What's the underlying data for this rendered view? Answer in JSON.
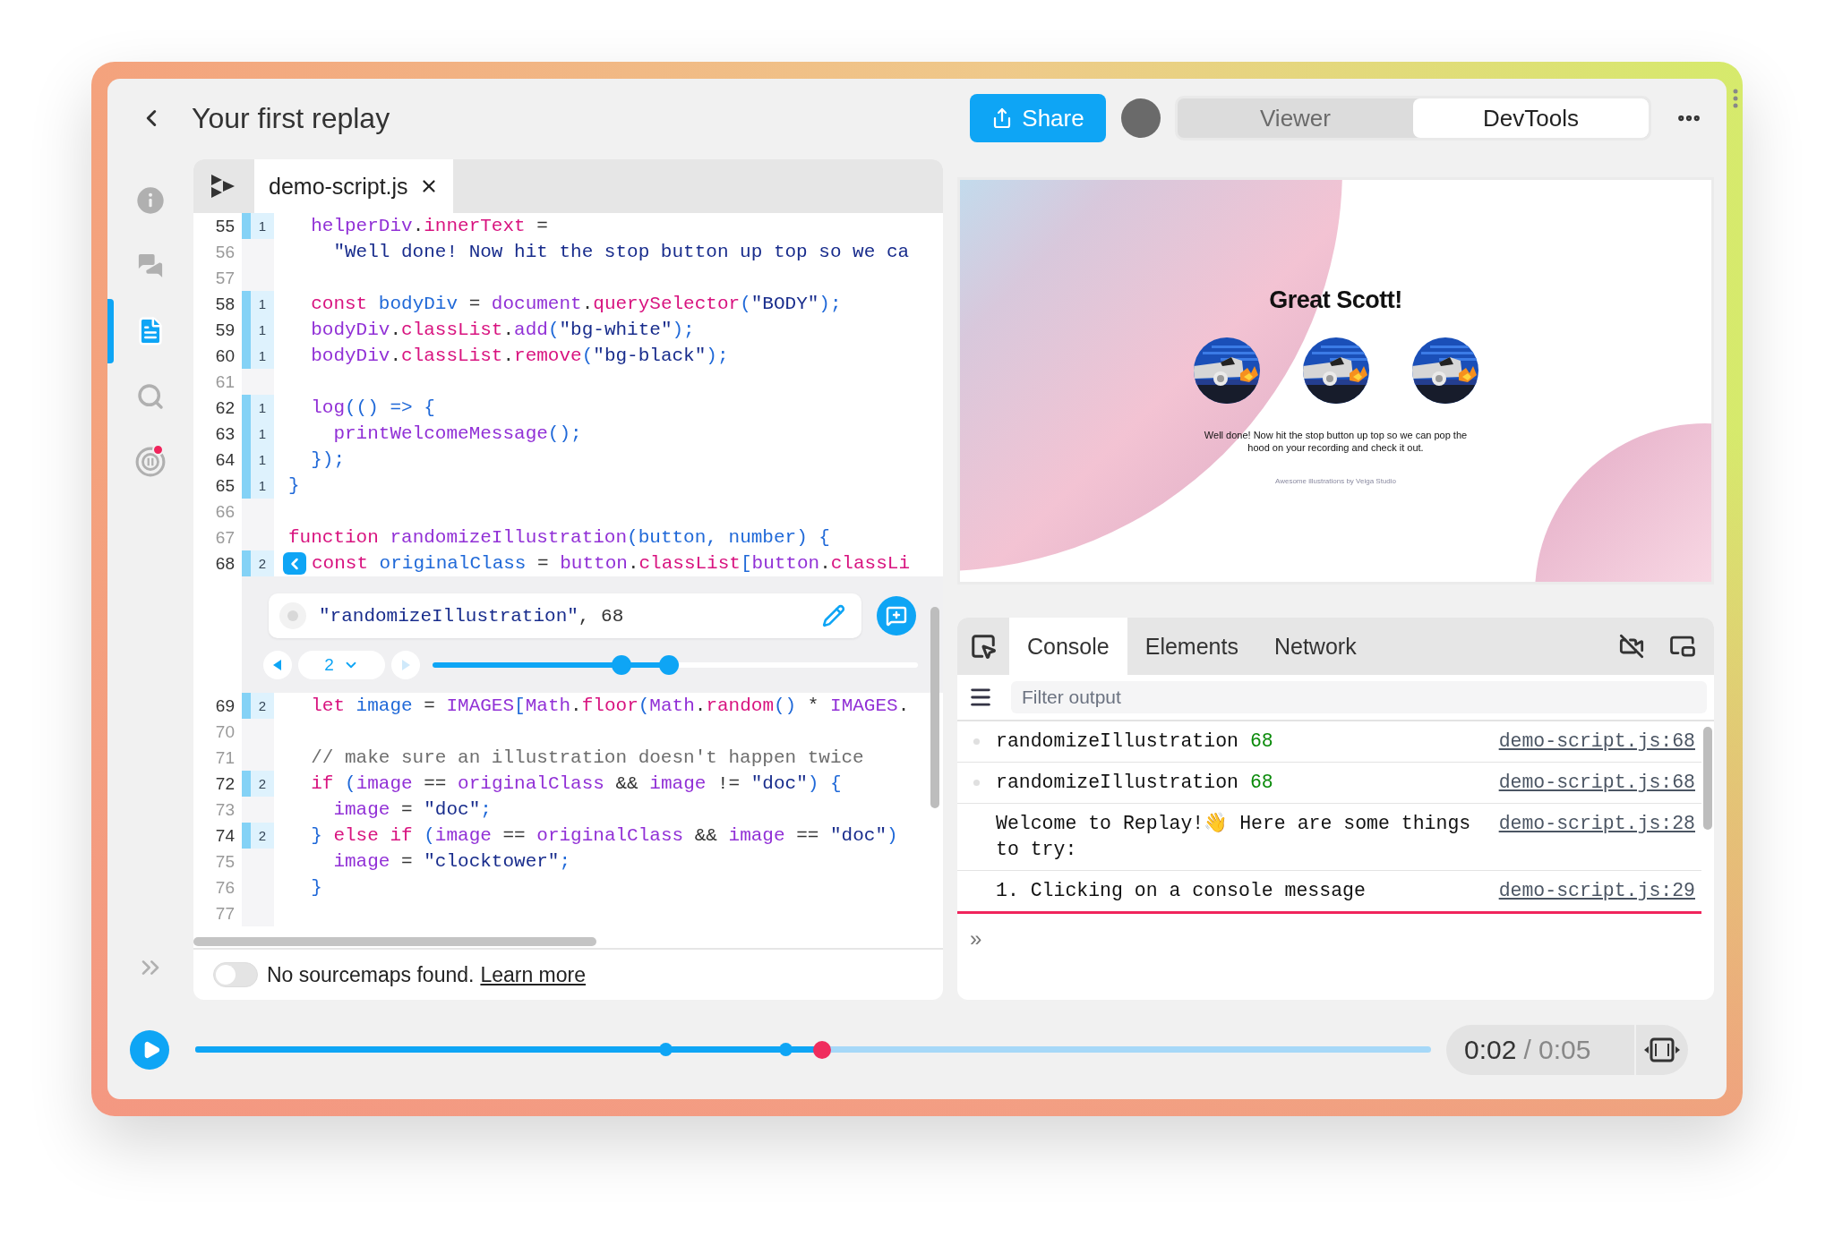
{
  "window": {
    "title": "Your first replay"
  },
  "header": {
    "share": "Share",
    "view_toggle": [
      {
        "label": "Viewer",
        "selected": false
      },
      {
        "label": "DevTools",
        "selected": true
      }
    ]
  },
  "sidebar": {
    "items": [
      {
        "selected": false,
        "badge": false
      },
      {
        "selected": false,
        "badge": false
      },
      {
        "selected": true,
        "badge": false
      },
      {
        "selected": false,
        "badge": false
      },
      {
        "selected": false,
        "badge": true
      }
    ]
  },
  "editor": {
    "tab": {
      "label": "demo-script.js"
    },
    "lines": [
      {
        "number": "55",
        "hits": "1",
        "current": false,
        "tokens": [
          {
            "kind": "var",
            "text": "  helperDiv"
          },
          {
            "kind": "plain",
            "text": "."
          },
          {
            "kind": "prop",
            "text": "innerText"
          },
          {
            "kind": "plain",
            "text": " ="
          }
        ]
      },
      {
        "number": "56",
        "current": false,
        "tokens": [
          {
            "kind": "str",
            "text": "    \"Well done! Now hit the stop button up top so we ca"
          }
        ]
      },
      {
        "number": "57",
        "current": false
      },
      {
        "number": "58",
        "hits": "1",
        "current": false,
        "tokens": [
          {
            "kind": "kw",
            "text": "  const"
          },
          {
            "kind": "def",
            "text": " bodyDiv"
          },
          {
            "kind": "plain",
            "text": " = "
          },
          {
            "kind": "var",
            "text": "document"
          },
          {
            "kind": "plain",
            "text": "."
          },
          {
            "kind": "prop",
            "text": "querySelector"
          },
          {
            "kind": "punct",
            "text": "("
          },
          {
            "kind": "str",
            "text": "\"BODY\""
          },
          {
            "kind": "punct",
            "text": ");"
          }
        ]
      },
      {
        "number": "59",
        "hits": "1",
        "current": false,
        "tokens": [
          {
            "kind": "var",
            "text": "  bodyDiv"
          },
          {
            "kind": "plain",
            "text": "."
          },
          {
            "kind": "prop",
            "text": "classList"
          },
          {
            "kind": "plain",
            "text": "."
          },
          {
            "kind": "var",
            "text": "add"
          },
          {
            "kind": "punct",
            "text": "("
          },
          {
            "kind": "str",
            "text": "\"bg-white\""
          },
          {
            "kind": "punct",
            "text": ");"
          }
        ]
      },
      {
        "number": "60",
        "hits": "1",
        "current": false,
        "tokens": [
          {
            "kind": "var",
            "text": "  bodyDiv"
          },
          {
            "kind": "plain",
            "text": "."
          },
          {
            "kind": "prop",
            "text": "classList"
          },
          {
            "kind": "plain",
            "text": "."
          },
          {
            "kind": "prop",
            "text": "remove"
          },
          {
            "kind": "punct",
            "text": "("
          },
          {
            "kind": "str",
            "text": "\"bg-black\""
          },
          {
            "kind": "punct",
            "text": ");"
          }
        ]
      },
      {
        "number": "61",
        "current": false
      },
      {
        "number": "62",
        "hits": "1",
        "current": false,
        "tokens": [
          {
            "kind": "var",
            "text": "  log"
          },
          {
            "kind": "punct",
            "text": "(() => {"
          }
        ]
      },
      {
        "number": "63",
        "hits": "1",
        "current": false,
        "tokens": [
          {
            "kind": "var",
            "text": "    printWelcomeMessage"
          },
          {
            "kind": "punct",
            "text": "();"
          }
        ]
      },
      {
        "number": "64",
        "hits": "1",
        "current": false,
        "tokens": [
          {
            "kind": "punct",
            "text": "  });"
          }
        ]
      },
      {
        "number": "65",
        "hits": "1",
        "current": false,
        "tokens": [
          {
            "kind": "punct",
            "text": "}"
          }
        ]
      },
      {
        "number": "66",
        "current": false
      },
      {
        "number": "67",
        "current": false,
        "tokens": [
          {
            "kind": "kw",
            "text": "function"
          },
          {
            "kind": "var",
            "text": " randomizeIllustration"
          },
          {
            "kind": "punct",
            "text": "("
          },
          {
            "kind": "def",
            "text": "button"
          },
          {
            "kind": "punct",
            "text": ", "
          },
          {
            "kind": "def",
            "text": "number"
          },
          {
            "kind": "punct",
            "text": ") {"
          }
        ]
      },
      {
        "number": "68",
        "hits": "2",
        "current": true,
        "tokens": [
          {
            "kind": "kw",
            "text": "const"
          },
          {
            "kind": "def",
            "text": " originalClass"
          },
          {
            "kind": "plain",
            "text": " = "
          },
          {
            "kind": "var",
            "text": "button"
          },
          {
            "kind": "plain",
            "text": "."
          },
          {
            "kind": "prop",
            "text": "classList"
          },
          {
            "kind": "punct",
            "text": "["
          },
          {
            "kind": "var",
            "text": "button"
          },
          {
            "kind": "plain",
            "text": "."
          },
          {
            "kind": "prop",
            "text": "classLi"
          }
        ],
        "logpoint": {
          "tokens": [
            {
              "kind": "str",
              "text": "\"randomizeIllustration\""
            },
            {
              "kind": "plain",
              "text": ", 68"
            }
          ],
          "hit": "2",
          "prev_enabled": true,
          "next_enabled": false,
          "level": 0.487,
          "markers": [
            {
              "level": 0.389
            }
          ]
        }
      },
      {
        "number": "69",
        "hits": "2",
        "current": false,
        "tokens": [
          {
            "kind": "kw",
            "text": "  let"
          },
          {
            "kind": "def",
            "text": " image"
          },
          {
            "kind": "plain",
            "text": " = "
          },
          {
            "kind": "var",
            "text": "IMAGES"
          },
          {
            "kind": "punct",
            "text": "["
          },
          {
            "kind": "var",
            "text": "Math"
          },
          {
            "kind": "plain",
            "text": "."
          },
          {
            "kind": "prop",
            "text": "floor"
          },
          {
            "kind": "punct",
            "text": "("
          },
          {
            "kind": "var",
            "text": "Math"
          },
          {
            "kind": "plain",
            "text": "."
          },
          {
            "kind": "prop",
            "text": "random"
          },
          {
            "kind": "punct",
            "text": "()"
          },
          {
            "kind": "plain",
            "text": " * "
          },
          {
            "kind": "var",
            "text": "IMAGES"
          },
          {
            "kind": "plain",
            "text": "."
          }
        ]
      },
      {
        "number": "70",
        "current": false
      },
      {
        "number": "71",
        "current": false,
        "tokens": [
          {
            "kind": "comment",
            "text": "  // make sure an illustration doesn't happen twice"
          }
        ]
      },
      {
        "number": "72",
        "hits": "2",
        "current": false,
        "tokens": [
          {
            "kind": "kw",
            "text": "  if"
          },
          {
            "kind": "punct",
            "text": " ("
          },
          {
            "kind": "var",
            "text": "image"
          },
          {
            "kind": "plain",
            "text": " == "
          },
          {
            "kind": "var",
            "text": "originalClass"
          },
          {
            "kind": "plain",
            "text": " && "
          },
          {
            "kind": "var",
            "text": "image"
          },
          {
            "kind": "plain",
            "text": " != "
          },
          {
            "kind": "str",
            "text": "\"doc\""
          },
          {
            "kind": "punct",
            "text": ") {"
          }
        ]
      },
      {
        "number": "73",
        "current": false,
        "tokens": [
          {
            "kind": "var",
            "text": "    image"
          },
          {
            "kind": "plain",
            "text": " = "
          },
          {
            "kind": "str",
            "text": "\"doc\""
          },
          {
            "kind": "punct",
            "text": ";"
          }
        ]
      },
      {
        "number": "74",
        "hits": "2",
        "current": false,
        "tokens": [
          {
            "kind": "punct",
            "text": "  }"
          },
          {
            "kind": "kw",
            "text": " else if"
          },
          {
            "kind": "punct",
            "text": " ("
          },
          {
            "kind": "var",
            "text": "image"
          },
          {
            "kind": "plain",
            "text": " == "
          },
          {
            "kind": "var",
            "text": "originalClass"
          },
          {
            "kind": "plain",
            "text": " && "
          },
          {
            "kind": "var",
            "text": "image"
          },
          {
            "kind": "plain",
            "text": " == "
          },
          {
            "kind": "str",
            "text": "\"doc\""
          },
          {
            "kind": "punct",
            "text": ")"
          }
        ]
      },
      {
        "number": "75",
        "current": false,
        "tokens": [
          {
            "kind": "var",
            "text": "    image"
          },
          {
            "kind": "plain",
            "text": " = "
          },
          {
            "kind": "str",
            "text": "\"clocktower\""
          },
          {
            "kind": "punct",
            "text": ";"
          }
        ]
      },
      {
        "number": "76",
        "current": false,
        "tokens": [
          {
            "kind": "punct",
            "text": "  }"
          }
        ]
      },
      {
        "number": "77",
        "current": false
      }
    ],
    "footer": {
      "toggle_on": false,
      "message": "No sourcemaps found.",
      "link": "Learn more"
    }
  },
  "preview": {
    "heading": "Great Scott!",
    "message": "Well done! Now hit the stop button up top so we can pop the hood on your recording and check it out.",
    "credit": "Awesome illustrations by Veiga Studio"
  },
  "console": {
    "tabs": [
      {
        "label": "Console",
        "selected": true
      },
      {
        "label": "Elements",
        "selected": false
      },
      {
        "label": "Network",
        "selected": false
      }
    ],
    "filter": {
      "placeholder": "Filter output"
    },
    "messages": [
      {
        "kind": "log",
        "text": "randomizeIllustration",
        "value": "68",
        "source": "demo-script.js:68",
        "current": false
      },
      {
        "kind": "log",
        "text": "randomizeIllustration",
        "value": "68",
        "source": "demo-script.js:68",
        "current": false
      },
      {
        "kind": "text",
        "text": "Welcome to Replay!👋 Here are some things to try:",
        "source": "demo-script.js:28",
        "current": false
      },
      {
        "kind": "text",
        "text": "1. Clicking on a console message",
        "source": "demo-script.js:29",
        "current": true
      }
    ],
    "prompt": "»"
  },
  "timeline": {
    "level": 0.507,
    "markers": [
      {
        "level": 0.381
      },
      {
        "level": 0.478
      }
    ],
    "current": "0:02",
    "total": "/ 0:05"
  }
}
